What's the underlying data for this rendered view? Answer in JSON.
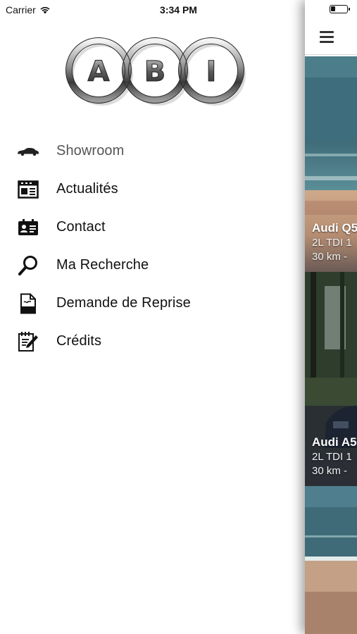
{
  "status_bar": {
    "carrier": "Carrier",
    "time": "3:34 PM"
  },
  "drawer": {
    "logo_letters": [
      "A",
      "B",
      "I"
    ],
    "menu": [
      {
        "label": "Showroom",
        "icon": "car-icon",
        "active": true
      },
      {
        "label": "Actualités",
        "icon": "newspaper-icon",
        "active": false
      },
      {
        "label": "Contact",
        "icon": "contact-card-icon",
        "active": false
      },
      {
        "label": "Ma Recherche",
        "icon": "search-icon",
        "active": false
      },
      {
        "label": "Demande de Reprise",
        "icon": "document-icon",
        "active": false
      },
      {
        "label": "Crédits",
        "icon": "edit-notepad-icon",
        "active": false
      }
    ]
  },
  "main": {
    "nav_icon": "hamburger-menu-icon",
    "cards": [
      {
        "title": "Audi Q5",
        "line1": "2L TDI 1",
        "line2": "30 km -"
      },
      {
        "title": "Audi A5",
        "line1": "2L TDI 1",
        "line2": "30 km -"
      },
      {
        "title": "",
        "line1": "",
        "line2": ""
      }
    ]
  }
}
